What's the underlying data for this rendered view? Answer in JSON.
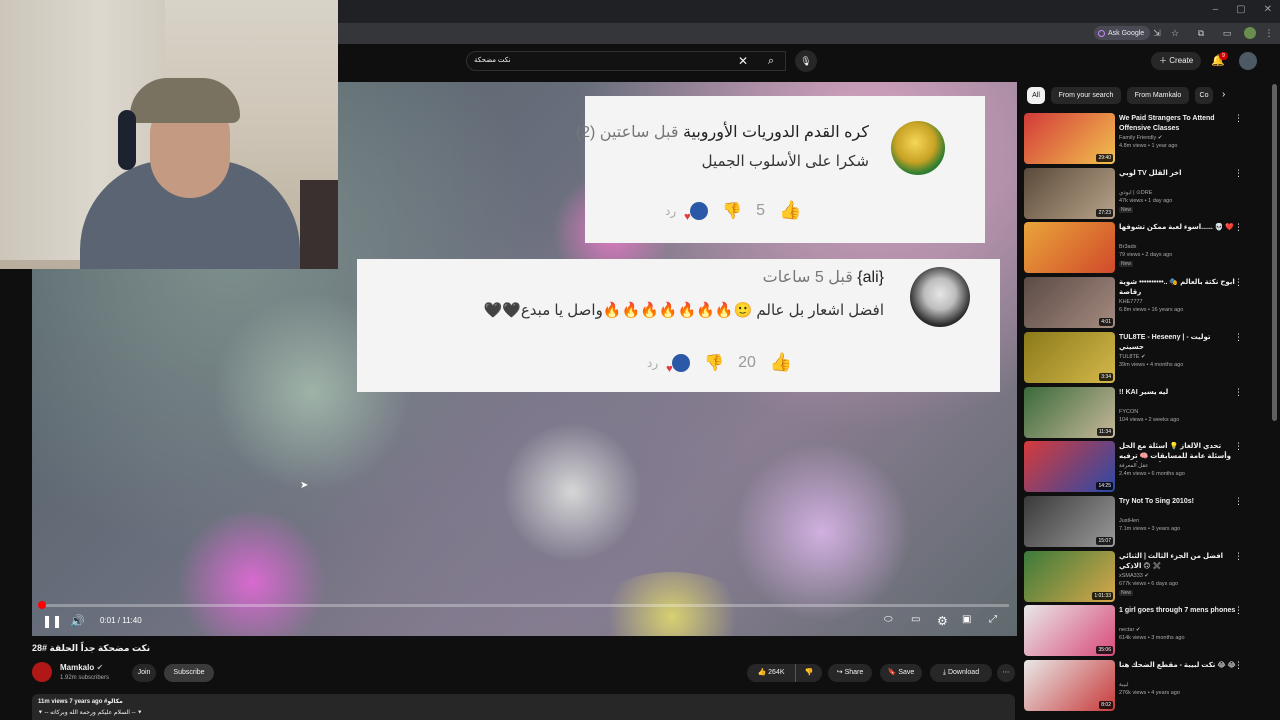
{
  "browser": {
    "ask_google": "Ask Google",
    "window_controls": [
      "–",
      "▢",
      "✕"
    ]
  },
  "masthead": {
    "search_query": "نكت مضحكة",
    "create_label": "Create",
    "notification_count": "9"
  },
  "player": {
    "comments": [
      {
        "avatar": "football-avatar",
        "header_name": "كره القدم الدوريات الأوروبية",
        "header_time": "قبل ساعتين (2)",
        "text": "شكرا على الأسلوب الجميل",
        "likes": "5",
        "reply": "رد"
      },
      {
        "avatar": "anime-avatar",
        "header_name": "{ali}",
        "header_time": "قبل 5 ساعات",
        "text": "افضل اشعار بل عالم 🙂🔥🔥🔥🔥🔥🔥🔥واصل يا مبدع🖤🖤",
        "likes": "20",
        "reply": "رد"
      }
    ],
    "time": "0:01 / 11:40",
    "progress_fraction": 0.0014
  },
  "video": {
    "title": "نكت مضحكة جداً الحلقة #28",
    "channel": "Mamkalo",
    "subscribers": "1.92m subscribers",
    "join_label": "Join",
    "subscribe_label": "Subscribe",
    "likes": "264K",
    "share_label": "Share",
    "save_label": "Save",
    "download_label": "Download",
    "views_date": "11m views  7 years ago  #مكالو",
    "description": "⯆ -- السلام عليكم ورحمة الله وبركاته -- ⯆"
  },
  "sidebar": {
    "chips": [
      "All",
      "From your search",
      "From Mamkalo",
      "Co"
    ],
    "recommendations": [
      {
        "title": "We Paid Strangers To Attend Offensive Classes",
        "channel": "Family Friendly ✔",
        "meta": "4.8m views • 1 year ago",
        "duration": "29:40",
        "badge": "",
        "colors": [
          "#d33a3a",
          "#f2c14e"
        ]
      },
      {
        "title": "لوبي TV آخر القلل",
        "channel": "ابودي | ⊙DRE",
        "meta": "47k views • 1 day ago",
        "duration": "27:23",
        "badge": "New",
        "colors": [
          "#5a4a3a",
          "#b9a48a"
        ]
      },
      {
        "title": "اسوء لعبة ممكن تشوفها...... 💀 ❤️",
        "channel": "Br3adx",
        "meta": "79 views • 2 days ago",
        "duration": "",
        "badge": "New",
        "colors": [
          "#e9a53a",
          "#d14a2a"
        ]
      },
      {
        "title": "ابوح نكتة بالعالم 🎭 ..•••••••••• شوية رقاصة",
        "channel": "KHE7777",
        "meta": "6.8m views • 16 years ago",
        "duration": "4:01",
        "badge": "",
        "colors": [
          "#5b4a45",
          "#a58b80"
        ]
      },
      {
        "title": "TUL8TE - Heseeny | توليت - حسيني",
        "channel": "TUL8TE ✔",
        "meta": "39m views • 4 months ago",
        "duration": "3:34",
        "badge": "",
        "colors": [
          "#8b7a1a",
          "#d4b84a"
        ]
      },
      {
        "title": "!! KAI ليه يسير",
        "channel": "FYCON",
        "meta": "104 views • 2 weeks ago",
        "duration": "11:34",
        "badge": "",
        "colors": [
          "#3a6a3a",
          "#c8b89a"
        ]
      },
      {
        "title": "تحدي الألغاز 💡 أسئلة مع الحل وأسئلة عامة للمسابقات 🧠 ترفيه و ألغاز للأذكياء !!",
        "channel": "عقل المعرفة",
        "meta": "2.4m views • 6 months ago",
        "duration": "14:25",
        "badge": "",
        "colors": [
          "#d83a3a",
          "#2a4aa8"
        ]
      },
      {
        "title": "Try Not To Sing 2010s!",
        "channel": "JustHen",
        "meta": "7.1m views • 3 years ago",
        "duration": "15:07",
        "badge": "",
        "colors": [
          "#3a3a3a",
          "#9a9a9a"
        ]
      },
      {
        "title": "افضل من الجزء الثالث | الثنائي الاذكي 🙃 ✖️",
        "channel": "xSMA333 ✔",
        "meta": "677k views • 6 days ago",
        "duration": "1:01:33",
        "badge": "New",
        "colors": [
          "#3a7a3a",
          "#d8a84a"
        ]
      },
      {
        "title": "1 girl goes through 7 mens phones",
        "channel": "nectar ✔",
        "meta": "614k views • 3 months ago",
        "duration": "35:06",
        "badge": "",
        "colors": [
          "#e8e8e8",
          "#d84a7a"
        ]
      },
      {
        "title": "نكت لبيبة - مقطع الضحك هنا 😂 😂",
        "channel": "لبيبة",
        "meta": "276k views • 4 years ago",
        "duration": "8:02",
        "badge": "",
        "colors": [
          "#e8e8e8",
          "#c83a3a"
        ]
      }
    ]
  }
}
